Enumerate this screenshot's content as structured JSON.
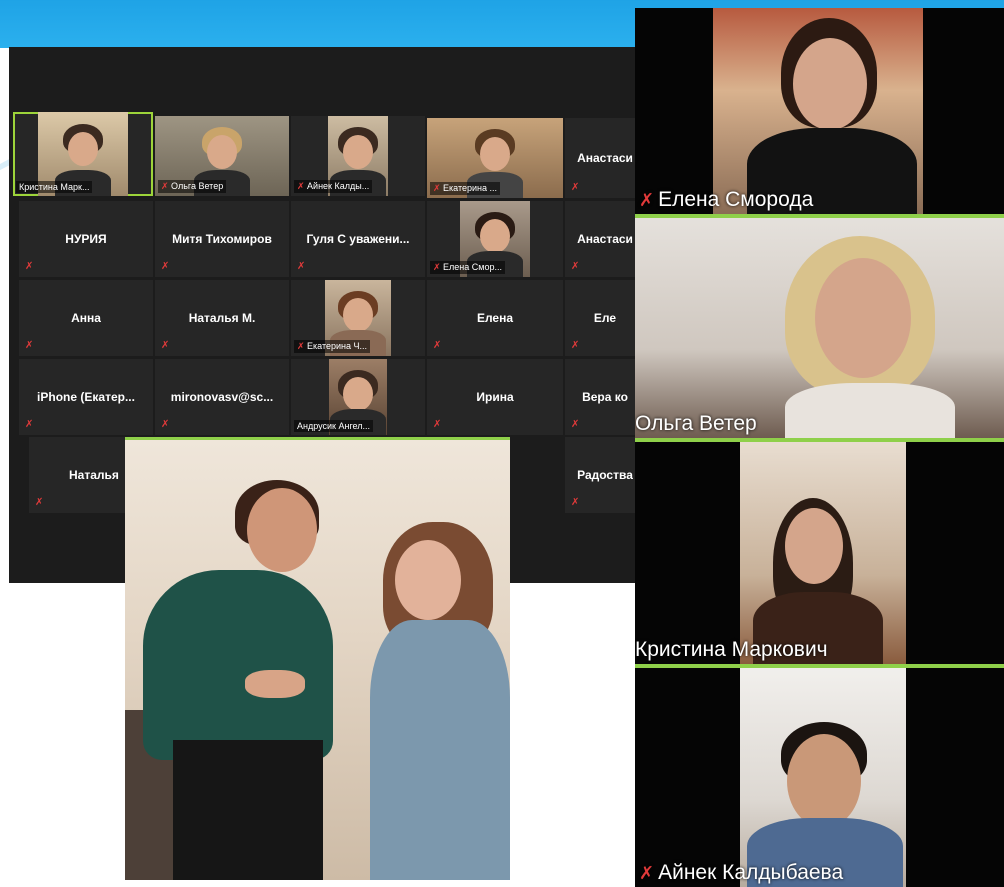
{
  "gallery": {
    "tiles": [
      {
        "label": "Кристина Марк..."
      },
      {
        "label": "Ольга Ветер"
      },
      {
        "label": "Айнек Калды..."
      },
      {
        "label": "Екатерина ..."
      },
      {
        "name": "Анастаси"
      },
      {
        "name": "НУРИЯ"
      },
      {
        "name": "Митя Тихомиров"
      },
      {
        "name": "Гуля С уважени..."
      },
      {
        "label": "Елена Смор..."
      },
      {
        "name": "Анастаси"
      },
      {
        "name": "Анна"
      },
      {
        "name": "Наталья М."
      },
      {
        "label": "Екатерина Ч..."
      },
      {
        "name": "Елена"
      },
      {
        "name": "Еле"
      },
      {
        "name": "iPhone (Екатер..."
      },
      {
        "name": "mironovasv@sc..."
      },
      {
        "label": "Андрусик Ангел..."
      },
      {
        "name": "Ирина"
      },
      {
        "name": "Вера ко"
      },
      {
        "name": "Наталья"
      },
      {
        "name": "Радоства"
      }
    ]
  },
  "speakers": [
    {
      "name": "Елена Сморода"
    },
    {
      "name": "Ольга Ветер"
    },
    {
      "name": "Кристина Маркович"
    },
    {
      "name": "Айнек Калдыбаева"
    }
  ],
  "colors": {
    "accent_green": "#8fd04a",
    "top_band": "#1fa3e6",
    "muted_mic": "#e23a3a"
  }
}
